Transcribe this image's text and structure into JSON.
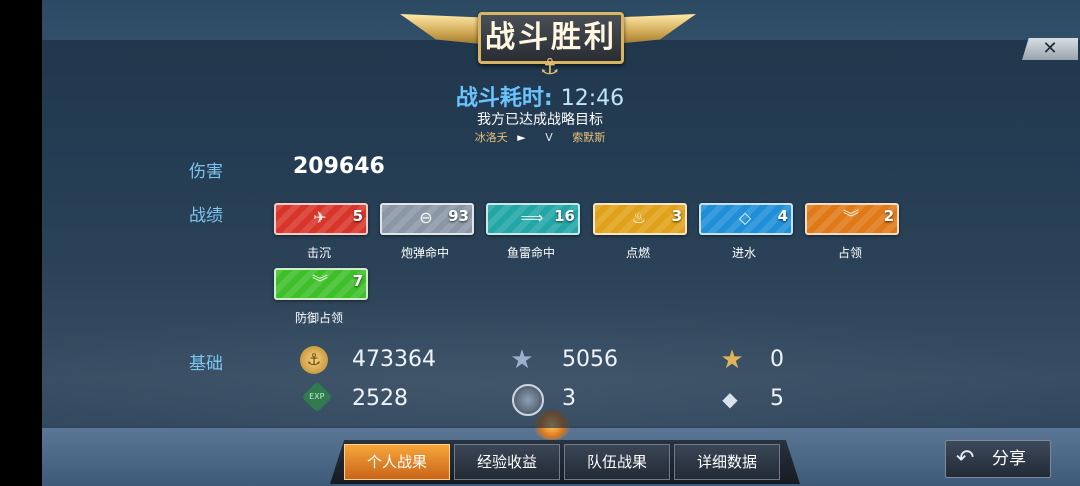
{
  "header": {
    "title": "战斗胜利",
    "duration_label": "战斗耗时:",
    "duration_value": "12:46",
    "objective": "我方已达成战略目标",
    "team_left": "冰洛夭",
    "vs": "V",
    "team_right": "索默斯"
  },
  "damage": {
    "label": "伤害",
    "value": "209646"
  },
  "achievements": {
    "label": "战绩",
    "items": [
      {
        "label": "击沉",
        "count": "5",
        "color": "#d8352a",
        "icon": "sinking-ship-icon"
      },
      {
        "label": "炮弹命中",
        "count": "93",
        "color": "#8b97a6",
        "icon": "shell-icon"
      },
      {
        "label": "鱼雷命中",
        "count": "16",
        "color": "#22a6a6",
        "icon": "torpedo-icon"
      },
      {
        "label": "点燃",
        "count": "3",
        "color": "#e0a21a",
        "icon": "fire-icon"
      },
      {
        "label": "进水",
        "count": "4",
        "color": "#1f8fd8",
        "icon": "flooding-icon"
      },
      {
        "label": "占领",
        "count": "2",
        "color": "#e07a18",
        "icon": "capture-icon"
      },
      {
        "label": "防御占领",
        "count": "7",
        "color": "#3fbf2a",
        "icon": "defend-capture-icon"
      }
    ]
  },
  "base": {
    "label": "基础",
    "stats": [
      {
        "icon": "coin-icon",
        "value": "473364"
      },
      {
        "icon": "star-icon",
        "value": "5056"
      },
      {
        "icon": "winged-star-icon",
        "value": "0"
      },
      {
        "icon": "exp-icon",
        "value": "2528"
      },
      {
        "icon": "token-icon",
        "value": "3"
      },
      {
        "icon": "diamond-icon",
        "value": "5"
      }
    ]
  },
  "tabs": [
    "个人战果",
    "经验收益",
    "队伍战果",
    "详细数据"
  ],
  "share_label": "分享"
}
